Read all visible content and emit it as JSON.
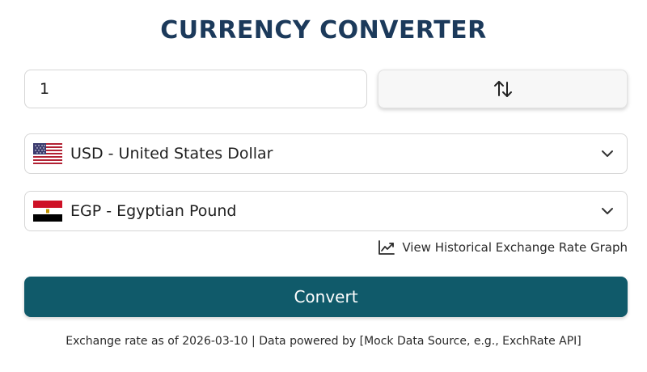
{
  "title": "CURRENCY CONVERTER",
  "amount": {
    "value": "1"
  },
  "swap": {
    "icon": "swap-vertical-arrows-icon"
  },
  "from_currency": {
    "label": "USD - United States Dollar",
    "flag": "us-flag-icon"
  },
  "to_currency": {
    "label": "EGP - Egyptian Pound",
    "flag": "egypt-flag-icon"
  },
  "history_link": {
    "label": "View Historical Exchange Rate Graph",
    "icon": "line-chart-icon"
  },
  "convert_button": {
    "label": "Convert"
  },
  "footer": {
    "note": "Exchange rate as of 2026-03-10 | Data powered by [Mock Data Source, e.g., ExchRate API]"
  },
  "colors": {
    "title": "#1c3a5b",
    "convert_button": "#105a6a",
    "border": "#d6d6d6"
  }
}
